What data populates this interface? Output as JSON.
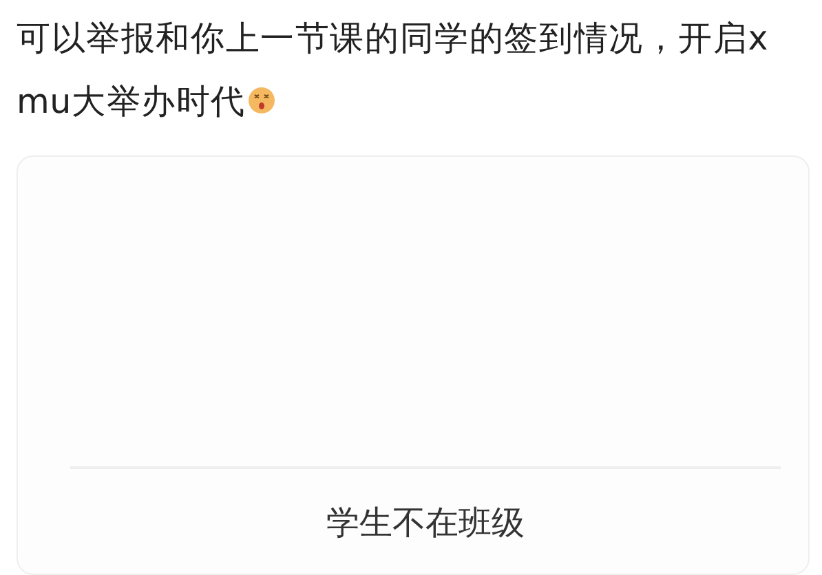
{
  "post": {
    "lines": [
      "可以举报和你上一节课的同学的签到情况，开启x",
      "mu大举办时代"
    ]
  },
  "dialog": {
    "options": [
      {
        "label": "学生不在班级"
      }
    ]
  }
}
